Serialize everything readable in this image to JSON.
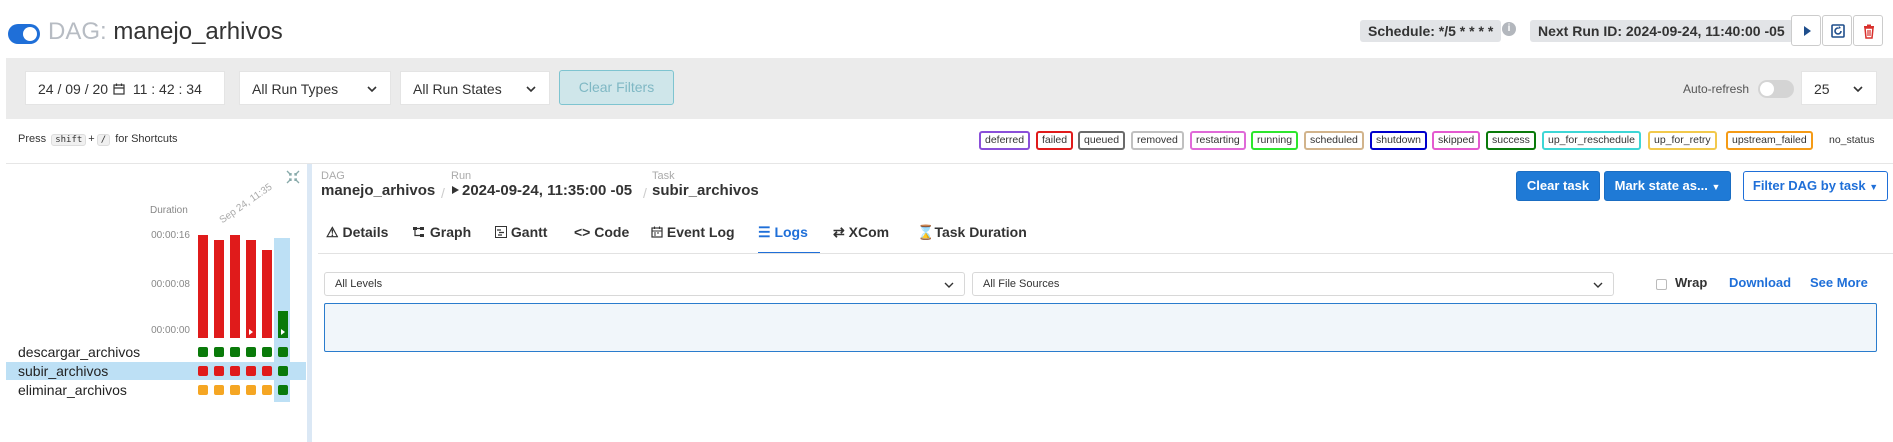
{
  "header": {
    "dag_prefix": "DAG:",
    "dag_name": "manejo_arhivos",
    "schedule": "Schedule: */5 * * * *",
    "next_run": "Next Run ID: 2024-09-24, 11:40:00 -05"
  },
  "filters": {
    "date": "24 / 09 / 20",
    "time": "11 : 42 : 34",
    "run_types": "All Run Types",
    "run_states": "All Run States",
    "clear_label": "Clear Filters",
    "auto_refresh_label": "Auto-refresh",
    "page_size": "25"
  },
  "shortcut_hint": {
    "press": "Press",
    "key1": "shift",
    "plus": "+",
    "key2": "/",
    "suffix": "for Shortcuts"
  },
  "legend": [
    {
      "label": "deferred",
      "color": "#8a4fd9"
    },
    {
      "label": "failed",
      "color": "#e01b1b"
    },
    {
      "label": "queued",
      "color": "#6b6b6b"
    },
    {
      "label": "removed",
      "color": "#c0c0c0"
    },
    {
      "label": "restarting",
      "color": "#e06ad8"
    },
    {
      "label": "running",
      "color": "#2ee62e"
    },
    {
      "label": "scheduled",
      "color": "#d2b48c"
    },
    {
      "label": "shutdown",
      "color": "#0000cc"
    },
    {
      "label": "skipped",
      "color": "#e45ad0"
    },
    {
      "label": "success",
      "color": "#0a7a0a"
    },
    {
      "label": "up_for_reschedule",
      "color": "#3ed6d6"
    },
    {
      "label": "up_for_retry",
      "color": "#f2c94c"
    },
    {
      "label": "upstream_failed",
      "color": "#f59b16"
    },
    {
      "label": "no_status",
      "color": "#ffffff"
    }
  ],
  "grid": {
    "duration_label": "Duration",
    "ticks": [
      "00:00:16",
      "00:00:08",
      "00:00:00"
    ],
    "run_date_label": "Sep 24, 11:35",
    "runs": [
      {
        "duration_s": 16.9,
        "state": "failed",
        "arrow": false
      },
      {
        "duration_s": 16.0,
        "state": "failed",
        "arrow": false
      },
      {
        "duration_s": 16.9,
        "state": "failed",
        "arrow": false
      },
      {
        "duration_s": 16.0,
        "state": "failed",
        "arrow": true
      },
      {
        "duration_s": 14.4,
        "state": "failed",
        "arrow": false
      },
      {
        "duration_s": 4.5,
        "state": "success",
        "arrow": true,
        "selected": true
      }
    ],
    "tasks": [
      {
        "name": "descargar_archivos",
        "states": [
          "success",
          "success",
          "success",
          "success",
          "success",
          "success"
        ]
      },
      {
        "name": "subir_archivos",
        "states": [
          "failed",
          "failed",
          "failed",
          "failed",
          "failed",
          "success"
        ],
        "selected": true
      },
      {
        "name": "eliminar_archivos",
        "states": [
          "upstream_failed",
          "upstream_failed",
          "upstream_failed",
          "upstream_failed",
          "upstream_failed",
          "success"
        ]
      }
    ],
    "state_colors": {
      "success": "#0a7a0a",
      "failed": "#e01b1b",
      "upstream_failed": "#f5a623"
    }
  },
  "detail": {
    "dag_label": "DAG",
    "dag_value": "manejo_arhivos",
    "run_label": "Run",
    "run_value": "2024-09-24, 11:35:00 -05",
    "task_label": "Task",
    "task_value": "subir_archivos",
    "clear_task": "Clear task",
    "mark_state": "Mark state as...",
    "filter_dag": "Filter DAG by task",
    "tabs": [
      "Details",
      "Graph",
      "Gantt",
      "Code",
      "Event Log",
      "Logs",
      "XCom",
      "Task Duration"
    ],
    "active_tab": "Logs",
    "levels": "All Levels",
    "file_sources": "All File Sources",
    "wrap": "Wrap",
    "download": "Download",
    "see_more": "See More"
  }
}
